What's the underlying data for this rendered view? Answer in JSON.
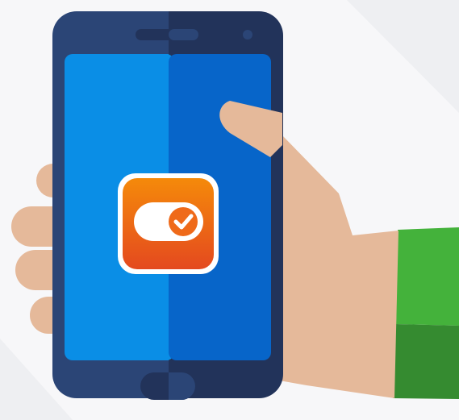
{
  "illustration": {
    "subject": "hand-holding-phone",
    "app_icon": "toggle-switch-check-icon",
    "colors": {
      "background": "#f7f7f9",
      "background_shadow": "#eeeff2",
      "phone_body_light": "#2b4576",
      "phone_body_dark": "#22335a",
      "screen_light": "#0a8ee6",
      "screen_dark": "#0765c9",
      "skin": "#e5b99a",
      "sleeve_light": "#44b23b",
      "sleeve_dark": "#358b30",
      "icon_gradient_top": "#f58a0a",
      "icon_gradient_bottom": "#e4491f",
      "icon_border": "#ffffff",
      "check_badge": "#ef6a1a"
    }
  }
}
